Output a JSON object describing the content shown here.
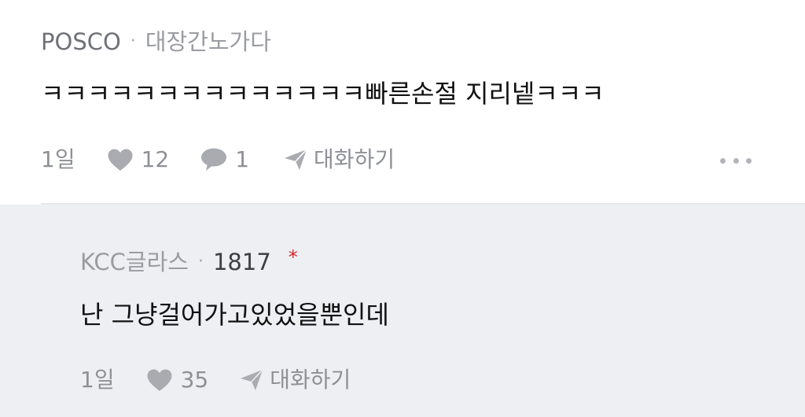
{
  "comments": [
    {
      "company": "POSCO",
      "separator": "·",
      "nickname": "대장간노가다",
      "text": "ㅋㅋㅋㅋㅋㅋㅋㅋㅋㅋㅋㅋㅋㅋ빠른손절 지리넽ㅋㅋㅋ",
      "time": "1일",
      "likes": "12",
      "replies": "1",
      "talk_label": "대화하기"
    },
    {
      "company": "KCC글라스",
      "separator": "·",
      "nickname": "1817",
      "badge": "*",
      "text": "난 그냥걸어가고있었을뿐인데",
      "time": "1일",
      "likes": "35",
      "talk_label": "대화하기"
    }
  ],
  "colors": {
    "reply_background": "#eeeff3",
    "meta_text": "#9a9ca2",
    "badge": "#d7262b",
    "icon": "#a9abb1"
  },
  "icons": {
    "like": "heart-icon",
    "reply": "speech-bubble-icon",
    "talk": "paper-plane-icon",
    "more": "more-dots-icon"
  }
}
